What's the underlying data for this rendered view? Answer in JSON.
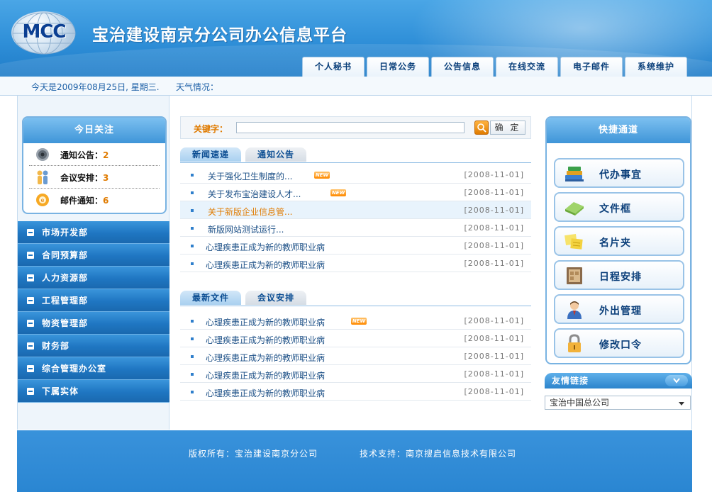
{
  "header": {
    "logo_text": "MCC",
    "title": "宝治建设南京分公司办公信息平台",
    "nav": [
      "个人秘书",
      "日常公务",
      "公告信息",
      "在线交流",
      "电子邮件",
      "系统维护"
    ]
  },
  "info": {
    "date": "今天是2009年08月25日, 星期三.",
    "weather": "天气情况："
  },
  "today": {
    "title": "今日关注",
    "items": [
      {
        "label": "通知公告：",
        "count": "2",
        "icon": "speaker-icon"
      },
      {
        "label": "会议安排：",
        "count": "3",
        "icon": "people-icon"
      },
      {
        "label": "邮件通知：",
        "count": "6",
        "icon": "mail-icon"
      }
    ]
  },
  "departments": [
    "市场开发部",
    "合同预算部",
    "人力资源部",
    "工程管理部",
    "物资管理部",
    "财务部",
    "综合管理办公室",
    "下属实体"
  ],
  "search": {
    "label": "关键字：",
    "value": "",
    "button": "确 定"
  },
  "news_tabs": [
    "新闻速递",
    "通知公告"
  ],
  "news": [
    {
      "title": "关于强化卫生制度的...",
      "date": "[2008-11-01]",
      "is_new": true
    },
    {
      "title": "关于发布宝治建设人才...",
      "date": "[2008-11-01]",
      "is_new": true
    },
    {
      "title": "关于新版企业信息管...",
      "date": "[2008-11-01]",
      "is_new": false
    },
    {
      "title": "新版网站测试运行...",
      "date": "[2008-11-01]",
      "is_new": false
    },
    {
      "title": "心理疾患正成为新的教师职业病",
      "date": "[2008-11-01]",
      "is_new": false
    },
    {
      "title": "心理疾患正成为新的教师职业病",
      "date": "[2008-11-01]",
      "is_new": false
    }
  ],
  "file_tabs": [
    "最新文件",
    "会议安排"
  ],
  "files": [
    {
      "title": "心理疾患正成为新的教师职业病",
      "date": "[2008-11-01]",
      "is_new": true
    },
    {
      "title": "心理疾患正成为新的教师职业病",
      "date": "[2008-11-01]",
      "is_new": false
    },
    {
      "title": "心理疾患正成为新的教师职业病",
      "date": "[2008-11-01]",
      "is_new": false
    },
    {
      "title": "心理疾患正成为新的教师职业病",
      "date": "[2008-11-01]",
      "is_new": false
    },
    {
      "title": "心理疾患正成为新的教师职业病",
      "date": "[2008-11-01]",
      "is_new": false
    }
  ],
  "new_badge": "NEW",
  "quick": {
    "title": "快捷通道",
    "items": [
      {
        "label": "代办事宜",
        "icon": "books-icon"
      },
      {
        "label": "文件框",
        "icon": "folder-icon"
      },
      {
        "label": "名片夹",
        "icon": "notes-icon"
      },
      {
        "label": "日程安排",
        "icon": "calendar-icon"
      },
      {
        "label": "外出管理",
        "icon": "person-icon"
      },
      {
        "label": "修改口令",
        "icon": "lock-icon"
      }
    ]
  },
  "friend_links": {
    "title": "友情链接",
    "selected": "宝治中国总公司"
  },
  "footer": {
    "copyright": "版权所有：宝治建设南京分公司",
    "support": "技术支持：南京搜启信息技术有限公司"
  },
  "colors": {
    "brand_blue": "#2f8fd8",
    "accent_orange": "#e07b00",
    "link_blue": "#1b4f86"
  }
}
